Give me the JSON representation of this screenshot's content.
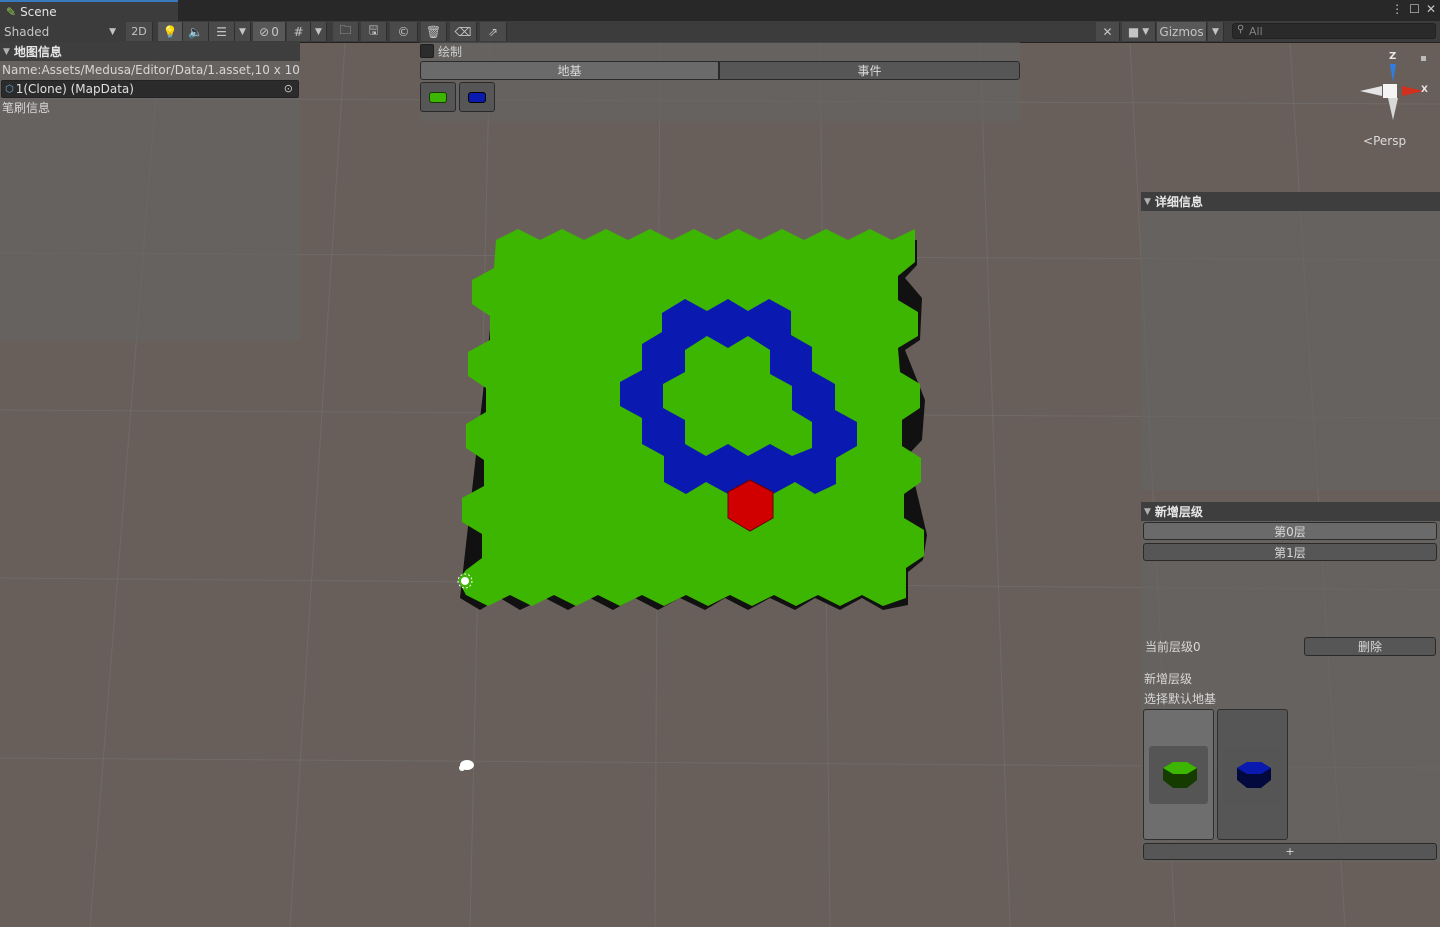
{
  "tab": {
    "title": "Scene"
  },
  "toolbar": {
    "shading_mode": "Shaded",
    "mode_2d": "2D",
    "hidden_count": "0",
    "gizmos_label": "Gizmos",
    "search_placeholder": "All"
  },
  "map_info": {
    "title": "地图信息",
    "name_line": "Name:Assets/Medusa/Editor/Data/1.asset,10 x 10",
    "object_field": "1(Clone) (MapData)",
    "brush_info": "笔刷信息"
  },
  "draw_panel": {
    "toggle_label": "绘制",
    "tabs": [
      "地基",
      "事件"
    ],
    "active_tab": "地基",
    "brushes": [
      "green-tile",
      "blue-tile"
    ]
  },
  "details": {
    "title": "详细信息"
  },
  "layers": {
    "title": "新增层级",
    "items": [
      "第0层",
      "第1层"
    ],
    "current_label": "当前层级0",
    "delete_label": "删除",
    "add_layer_label": "新增层级",
    "default_base_label": "选择默认地基",
    "tiles": [
      "green-tile",
      "blue-tile"
    ],
    "add_button": "+"
  },
  "gizmo": {
    "z": "Z",
    "x": "X",
    "projection": "Persp"
  },
  "colors": {
    "ground": "#3cb600",
    "wall": "#0a1ab0",
    "marker": "#d10000",
    "background": "#685f5b"
  }
}
